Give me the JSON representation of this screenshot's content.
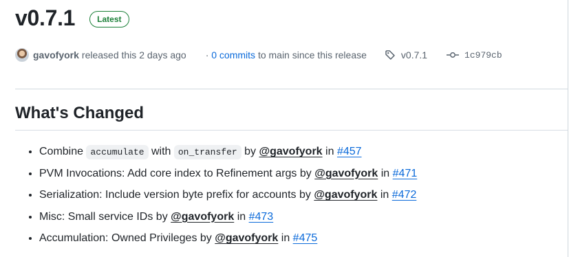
{
  "release": {
    "title": "v0.7.1",
    "badge": "Latest"
  },
  "meta": {
    "author": "gavofyork",
    "released_text": "released this 2 days ago",
    "commits_prefix": "·",
    "commits_link": "0 commits",
    "commits_suffix": "to main since this release",
    "tag": "v0.7.1",
    "commit_hash": "1c979cb",
    "icons": [
      "avatar",
      "tag-icon",
      "commit-icon"
    ]
  },
  "section": {
    "title": "What's Changed"
  },
  "changes": [
    {
      "pre": "Combine",
      "code1": "accumulate",
      "mid": "with",
      "code2": "on_transfer",
      "by": "by",
      "mention": "@gavofyork",
      "in": "in",
      "issue": "#457"
    },
    {
      "text": "PVM Invocations: Add core index to Refinement args by",
      "mention": "@gavofyork",
      "in": "in",
      "issue": "#471"
    },
    {
      "text": "Serialization: Include version byte prefix for accounts by",
      "mention": "@gavofyork",
      "in": "in",
      "issue": "#472"
    },
    {
      "text": "Misc: Small service IDs by",
      "mention": "@gavofyork",
      "in": "in",
      "issue": "#473"
    },
    {
      "text": "Accumulation: Owned Privileges by",
      "mention": "@gavofyork",
      "in": "in",
      "issue": "#475"
    }
  ],
  "colors": {
    "link": "#0969da",
    "latest_badge": "#1a7f37",
    "muted_text": "#59636e"
  }
}
